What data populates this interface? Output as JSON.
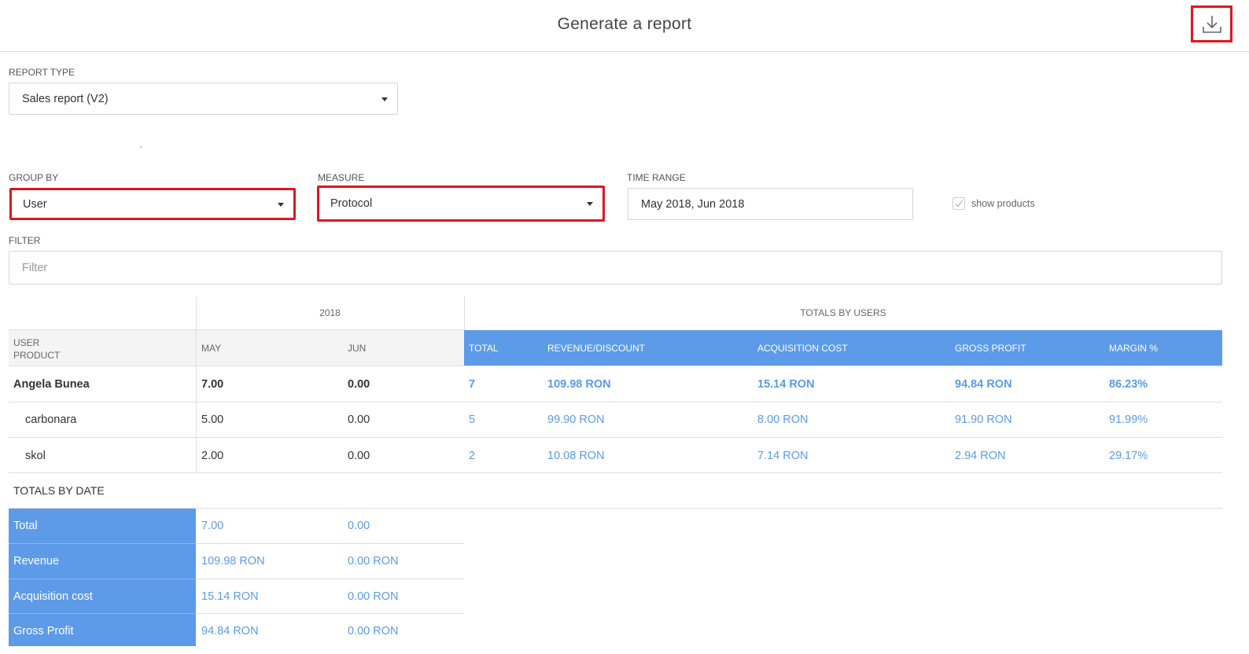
{
  "header": {
    "title": "Generate a report",
    "download_icon": "download-icon"
  },
  "report_type": {
    "label": "REPORT TYPE",
    "value": "Sales report (V2)"
  },
  "group_by": {
    "label": "GROUP BY",
    "value": "User"
  },
  "measure": {
    "label": "MEASURE",
    "value": "Protocol"
  },
  "time_range": {
    "label": "TIME RANGE",
    "value": "May 2018, Jun 2018"
  },
  "show_products": {
    "label": "show products",
    "checked": true
  },
  "filter": {
    "label": "FILTER",
    "placeholder": "Filter"
  },
  "table": {
    "year_header": "2018",
    "totals_by_users_header": "TOTALS BY USERS",
    "row_header_line1": "USER",
    "row_header_line2": "PRODUCT",
    "month_columns": [
      "MAY",
      "JUN"
    ],
    "total_columns": [
      "TOTAL",
      "REVENUE/DISCOUNT",
      "ACQUISITION COST",
      "GROSS PROFIT",
      "MARGIN %"
    ],
    "rows": [
      {
        "name": "Angela Bunea",
        "may": "7.00",
        "jun": "0.00",
        "total": "7",
        "revenue": "109.98 RON",
        "acquisition": "15.14 RON",
        "gross": "94.84 RON",
        "margin": "86.23%",
        "is_user": true
      },
      {
        "name": "carbonara",
        "may": "5.00",
        "jun": "0.00",
        "total": "5",
        "revenue": "99.90 RON",
        "acquisition": "8.00 RON",
        "gross": "91.90 RON",
        "margin": "91.99%",
        "is_user": false
      },
      {
        "name": "skol",
        "may": "2.00",
        "jun": "0.00",
        "total": "2",
        "revenue": "10.08 RON",
        "acquisition": "7.14 RON",
        "gross": "2.94 RON",
        "margin": "29.17%",
        "is_user": false
      }
    ]
  },
  "totals_by_date": {
    "title": "TOTALS BY DATE",
    "rows": [
      {
        "label": "Total",
        "may": "7.00",
        "jun": "0.00"
      },
      {
        "label": "Revenue",
        "may": "109.98 RON",
        "jun": "0.00 RON"
      },
      {
        "label": "Acquisition cost",
        "may": "15.14 RON",
        "jun": "0.00 RON"
      },
      {
        "label": "Gross Profit",
        "may": "94.84 RON",
        "jun": "0.00 RON"
      }
    ]
  },
  "colors": {
    "accent_blue": "#5d9be8",
    "highlight_red": "#e3141e"
  }
}
